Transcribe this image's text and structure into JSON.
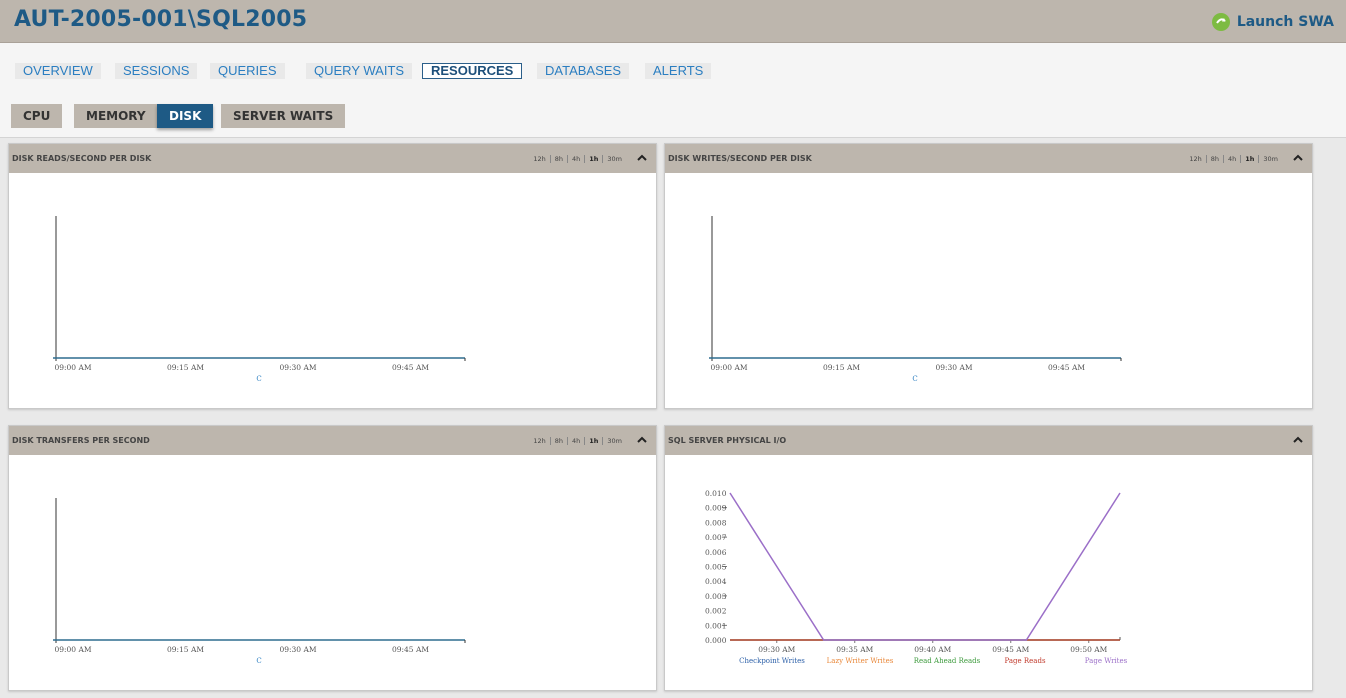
{
  "header": {
    "title": "AUT-2005-001\\SQL2005",
    "launch_label": "Launch SWA"
  },
  "tabs": [
    {
      "label": "OVERVIEW",
      "active": false
    },
    {
      "label": "SESSIONS",
      "active": false
    },
    {
      "label": "QUERIES",
      "active": false
    },
    {
      "label": "QUERY WAITS",
      "active": false
    },
    {
      "label": "RESOURCES",
      "active": true
    },
    {
      "label": "DATABASES",
      "active": false
    },
    {
      "label": "ALERTS",
      "active": false
    }
  ],
  "subtabs": [
    {
      "label": "CPU",
      "active": false
    },
    {
      "label": "MEMORY",
      "active": false
    },
    {
      "label": "DISK",
      "active": true
    },
    {
      "label": "SERVER WAITS",
      "active": false
    }
  ],
  "time_ranges": [
    "12h",
    "8h",
    "4h",
    "1h",
    "30m"
  ],
  "selected_range": "1h",
  "panels": [
    {
      "title": "DISK READS/SECOND PER DISK",
      "has_ranges": true
    },
    {
      "title": "DISK WRITES/SECOND PER DISK",
      "has_ranges": true
    },
    {
      "title": "DISK TRANSFERS PER SECOND",
      "has_ranges": true
    },
    {
      "title": "SQL SERVER PHYSICAL I/O",
      "has_ranges": false
    }
  ],
  "colors": {
    "brand_blue": "#1e5a85",
    "header_tan": "#bdb6ad",
    "launch_green": "#7dbb42",
    "axis_line": "#2e6d8f"
  },
  "chart_data": [
    {
      "type": "line",
      "x_ticks": [
        "09:00 AM",
        "09:15 AM",
        "09:30 AM",
        "09:45 AM"
      ],
      "series": [
        {
          "name": "C",
          "values": []
        }
      ],
      "legend": [
        "C"
      ]
    },
    {
      "type": "line",
      "x_ticks": [
        "09:00 AM",
        "09:15 AM",
        "09:30 AM",
        "09:45 AM"
      ],
      "series": [
        {
          "name": "C",
          "values": []
        }
      ],
      "legend": [
        "C"
      ]
    },
    {
      "type": "line",
      "x_ticks": [
        "09:00 AM",
        "09:15 AM",
        "09:30 AM",
        "09:45 AM"
      ],
      "series": [
        {
          "name": "C",
          "values": []
        }
      ],
      "legend": [
        "C"
      ]
    },
    {
      "type": "line",
      "x_ticks": [
        "09:30 AM",
        "09:35 AM",
        "09:40 AM",
        "09:45 AM",
        "09:50 AM"
      ],
      "y_ticks": [
        "0.010",
        "0.009",
        "0.008",
        "0.007",
        "0.006",
        "0.005",
        "0.004",
        "0.003",
        "0.002",
        "0.001",
        "0.000"
      ],
      "ylim": [
        0,
        0.01
      ],
      "x": [
        "09:27 AM",
        "09:33 AM",
        "09:46 AM",
        "09:52 AM"
      ],
      "series": [
        {
          "name": "Checkpoint Writes",
          "color": "#2b5fa8",
          "values": [
            0,
            0,
            0,
            0
          ]
        },
        {
          "name": "Lazy Writer Writes",
          "color": "#e9883a",
          "values": [
            0,
            0,
            0,
            0
          ]
        },
        {
          "name": "Read Ahead Reads",
          "color": "#3c9a3c",
          "values": [
            0,
            0,
            0,
            0
          ]
        },
        {
          "name": "Page Reads",
          "color": "#c0392b",
          "values": [
            0,
            0,
            0,
            0
          ]
        },
        {
          "name": "Page Writes",
          "color": "#9b6fc8",
          "values": [
            0.01,
            0,
            0,
            0.01
          ]
        }
      ]
    }
  ]
}
